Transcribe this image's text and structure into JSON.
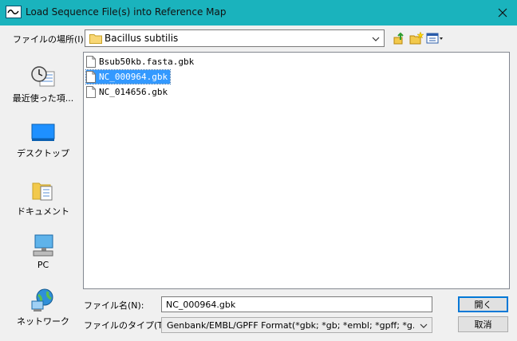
{
  "window": {
    "title": "Load Sequence File(s) into Reference Map"
  },
  "lookin": {
    "label": "ファイルの場所(I):",
    "value": "Bacillus subtilis"
  },
  "places": [
    {
      "label": "最近使った項..."
    },
    {
      "label": "デスクトップ"
    },
    {
      "label": "ドキュメント"
    },
    {
      "label": "PC"
    },
    {
      "label": "ネットワーク"
    }
  ],
  "files": [
    {
      "name": "Bsub50kb.fasta.gbk",
      "selected": false
    },
    {
      "name": "NC_000964.gbk",
      "selected": true
    },
    {
      "name": "NC_014656.gbk",
      "selected": false
    }
  ],
  "filename": {
    "label": "ファイル名(N):",
    "value": "NC_000964.gbk"
  },
  "filetype": {
    "label": "ファイルのタイプ(T):",
    "value": "Genbank/EMBL/GPFF Format(*gbk; *gb; *embl; *gpff; *g..."
  },
  "buttons": {
    "open": "開く",
    "cancel": "取消"
  },
  "colors": {
    "titlebar": "#1ab3bd",
    "selection": "#3399ff",
    "default_button_border": "#0078d7"
  },
  "icons": [
    "app-icon",
    "close-icon",
    "folder-icon",
    "up-folder-icon",
    "new-folder-icon",
    "view-menu-icon",
    "recent-icon",
    "desktop-icon",
    "documents-icon",
    "pc-icon",
    "network-icon",
    "document-icon"
  ]
}
